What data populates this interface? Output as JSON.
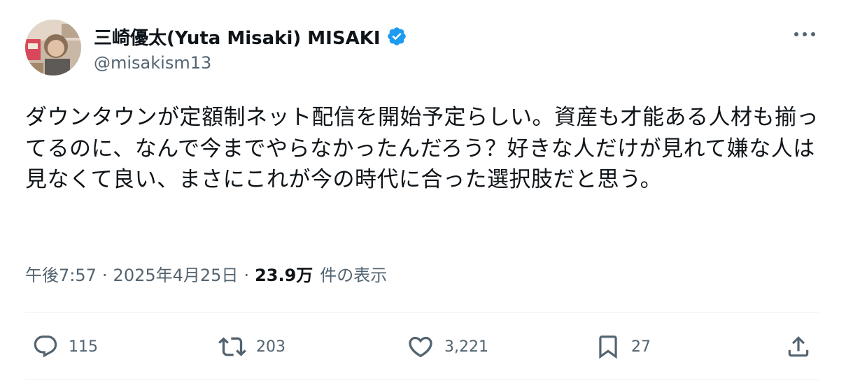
{
  "user": {
    "display_name": "三崎優太(Yuta Misaki) MISAKI",
    "handle": "@misakism13",
    "verified": true
  },
  "tweet": {
    "text": "ダウンタウンが定額制ネット配信を開始予定らしい。資産も才能ある人材も揃ってるのに、なんで今までやらなかったんだろう？好きな人だけが見れて嫌な人は見なくて良い、まさにこれが今の時代に合った選択肢だと思う。",
    "time": "午後7:57",
    "date": "2025年4月25日",
    "separator": "·",
    "views_count": "23.9万",
    "views_label": "件の表示"
  },
  "actions": {
    "reply_count": "115",
    "retweet_count": "203",
    "like_count": "3,221",
    "bookmark_count": "27"
  },
  "colors": {
    "text_primary": "#0f1419",
    "text_secondary": "#536471",
    "verified_blue": "#1d9bf0",
    "divider": "#eff3f4"
  },
  "icons": {
    "more": "more-dots-icon",
    "reply": "reply-bubble-icon",
    "retweet": "retweet-arrows-icon",
    "like": "heart-icon",
    "bookmark": "bookmark-icon",
    "share": "share-upload-icon",
    "verified": "verified-badge-icon"
  }
}
